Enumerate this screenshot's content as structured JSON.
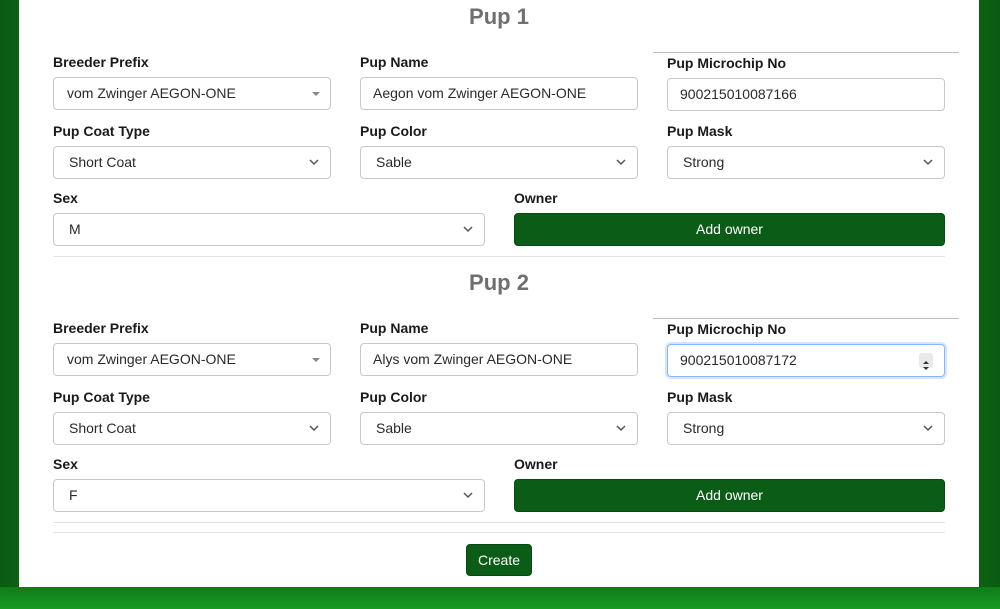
{
  "form": {
    "pups": [
      {
        "title": "Pup 1",
        "breeder_prefix_label": "Breeder Prefix",
        "breeder_prefix_value": "vom Zwinger AEGON-ONE",
        "pup_name_label": "Pup Name",
        "pup_name_value": "Aegon vom Zwinger AEGON-ONE",
        "microchip_label": "Pup Microchip No",
        "microchip_value": "900215010087166",
        "coat_type_label": "Pup Coat Type",
        "coat_type_value": "Short Coat",
        "color_label": "Pup Color",
        "color_value": "Sable",
        "mask_label": "Pup Mask",
        "mask_value": "Strong",
        "sex_label": "Sex",
        "sex_value": "M",
        "owner_label": "Owner",
        "add_owner_label": "Add owner"
      },
      {
        "title": "Pup 2",
        "breeder_prefix_label": "Breeder Prefix",
        "breeder_prefix_value": "vom Zwinger AEGON-ONE",
        "pup_name_label": "Pup Name",
        "pup_name_value": "Alys vom Zwinger AEGON-ONE",
        "microchip_label": "Pup Microchip No",
        "microchip_value": "900215010087172",
        "coat_type_label": "Pup Coat Type",
        "coat_type_value": "Short Coat",
        "color_label": "Pup Color",
        "color_value": "Sable",
        "mask_label": "Pup Mask",
        "mask_value": "Strong",
        "sex_label": "Sex",
        "sex_value": "F",
        "owner_label": "Owner",
        "add_owner_label": "Add owner"
      }
    ],
    "create_label": "Create"
  },
  "colors": {
    "button_green": "#0b5c17",
    "page_background_green": "#0e7a18",
    "focus_border": "#86b7fe"
  }
}
